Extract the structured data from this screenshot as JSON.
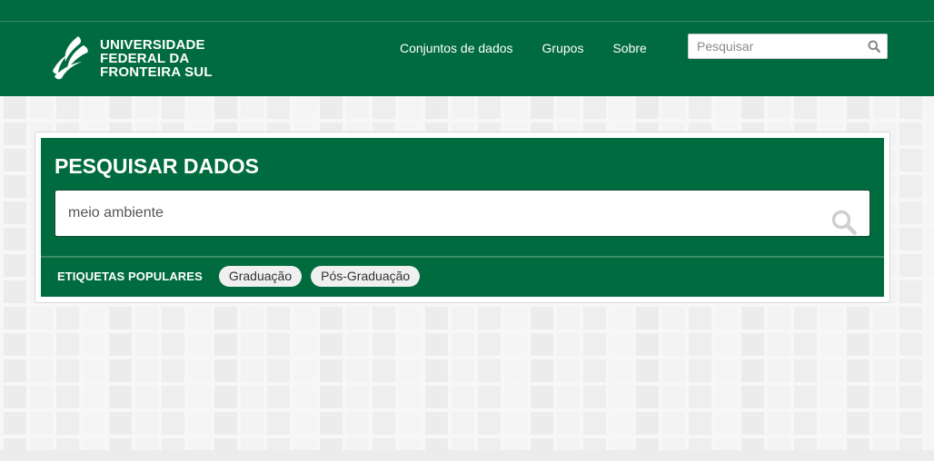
{
  "brand": {
    "line1": "UNIVERSIDADE",
    "line2": "FEDERAL DA",
    "line3": "FRONTEIRA SUL",
    "logo_icon": "leaf-swoosh-icon",
    "color": "#006b3e"
  },
  "nav": {
    "items": [
      {
        "label": "Conjuntos de dados"
      },
      {
        "label": "Grupos"
      },
      {
        "label": "Sobre"
      }
    ]
  },
  "header_search": {
    "placeholder": "Pesquisar",
    "icon": "search-icon"
  },
  "hero": {
    "title": "PESQUISAR DADOS",
    "search": {
      "value": "meio ambiente",
      "icon": "search-icon"
    },
    "tags_label": "ETIQUETAS POPULARES",
    "tags": [
      {
        "label": "Graduação"
      },
      {
        "label": "Pós-Graduação"
      }
    ]
  }
}
